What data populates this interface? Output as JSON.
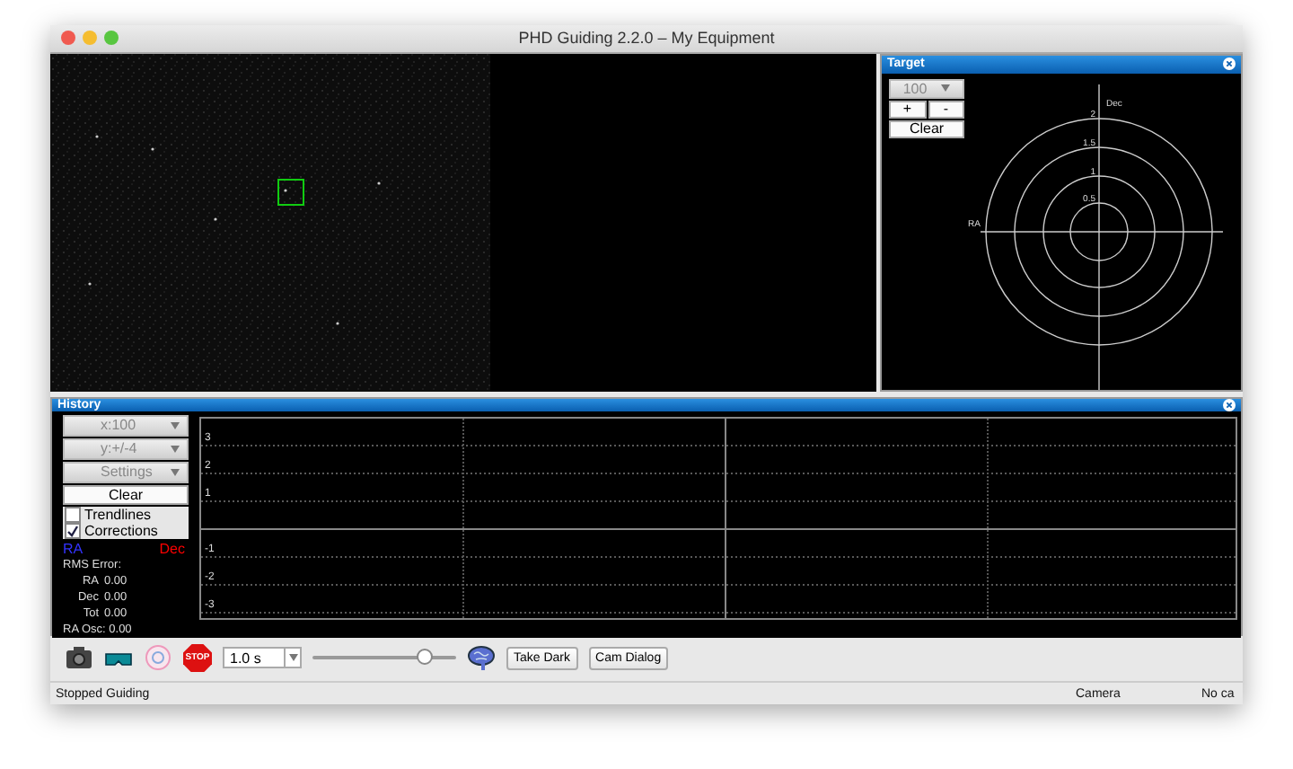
{
  "window": {
    "title": "PHD Guiding 2.2.0 – My Equipment"
  },
  "target": {
    "title": "Target",
    "scale": "100",
    "buttons": [
      "+",
      "-"
    ],
    "clear": "Clear",
    "dec_label": "Dec",
    "ra_label": "RA",
    "ring_labels": [
      "2",
      "1.5",
      "1",
      "0.5"
    ]
  },
  "history": {
    "title": "History",
    "dropdowns": [
      "x:100",
      "y:+/-4",
      "Settings"
    ],
    "clear": "Clear",
    "options": [
      {
        "label": "Trendlines",
        "checked": false
      },
      {
        "label": "Corrections",
        "checked": true
      }
    ],
    "legend": [
      {
        "label": "RA",
        "color": "#3333ff"
      },
      {
        "label": "Dec",
        "color": "#ff0000"
      }
    ],
    "rms_title": "RMS Error:",
    "stats": [
      {
        "label": "RA",
        "value": "0.00"
      },
      {
        "label": "Dec",
        "value": "0.00"
      },
      {
        "label": "Tot",
        "value": "0.00"
      }
    ],
    "osc": "RA Osc: 0.00",
    "y_labels": [
      "3",
      "2",
      "1",
      "-1",
      "-2",
      "-3"
    ]
  },
  "toolbar": {
    "stop": "STOP",
    "exposure": "1.0 s",
    "slider": {
      "level": 0.77
    },
    "buttons": [
      "Take Dark",
      "Cam Dialog"
    ]
  },
  "status_bar": [
    {
      "kind": "message",
      "text": "Stopped Guiding"
    },
    {
      "kind": "field",
      "text": "Camera"
    },
    {
      "kind": "field",
      "text": "No ca"
    }
  ]
}
